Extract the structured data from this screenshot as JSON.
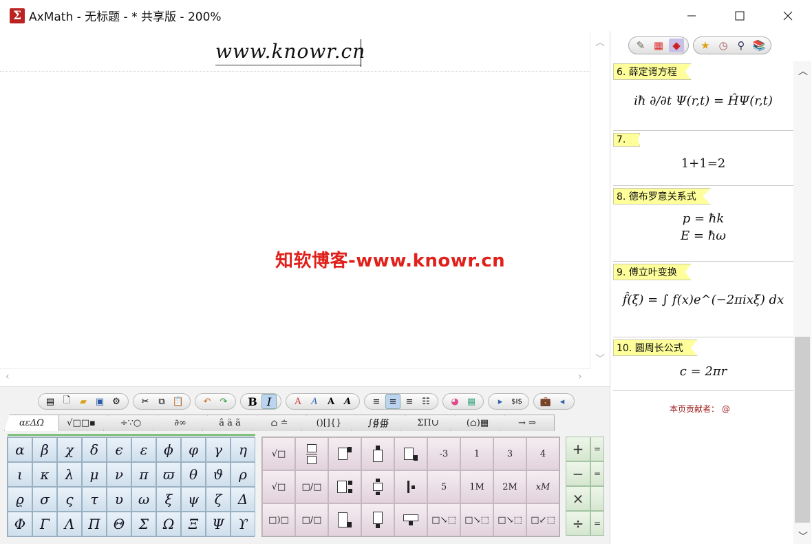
{
  "window": {
    "title": "AxMath - 无标题 - * 共享版 - 200%",
    "app_icon": "Σ",
    "minimize": "minimize-icon",
    "maximize": "maximize-icon",
    "close": "close-icon"
  },
  "editor": {
    "formula": "www.knowr.cn",
    "watermark": "知软博客-www.knowr.cn"
  },
  "toolbar": {
    "bold": "B",
    "italic": "I",
    "font_a1": "A",
    "font_a2": "A",
    "font_a3": "A",
    "font_a4": "A"
  },
  "tabs": [
    "αεΔΩ",
    "√□□▪",
    "÷∵○",
    "∂∞",
    "â ä ã",
    "⌂ ≐",
    "()[]{}",
    "∫∯∰",
    "ΣΠ∪",
    "(⌂)▦",
    "→ ⇒"
  ],
  "greek": [
    [
      "α",
      "β",
      "χ",
      "δ",
      "ϵ",
      "ε",
      "ϕ",
      "φ",
      "γ",
      "η"
    ],
    [
      "ι",
      "κ",
      "λ",
      "μ",
      "ν",
      "π",
      "ϖ",
      "θ",
      "ϑ",
      "ρ"
    ],
    [
      "ϱ",
      "σ",
      "ς",
      "τ",
      "υ",
      "ω",
      "ξ",
      "ψ",
      "ζ",
      "Δ"
    ],
    [
      "Φ",
      "Γ",
      "Λ",
      "Π",
      "Θ",
      "Σ",
      "Ω",
      "Ξ",
      "Ψ",
      "ϒ"
    ]
  ],
  "templates": {
    "row1": [
      "√□",
      "□/□",
      "",
      "",
      "",
      "-3",
      "1",
      "3",
      "4"
    ],
    "row2": [
      "√□",
      "□/□",
      "",
      "",
      "",
      "5",
      "1M",
      "2M",
      "xM"
    ],
    "row3": [
      "□)□",
      "□/□",
      "",
      "",
      "",
      "",
      "",
      "",
      ""
    ]
  },
  "operators": [
    "+",
    "−",
    "×",
    "÷"
  ],
  "sidebar": {
    "entries": [
      {
        "tag": "6. 薛定谔方程",
        "lines": [
          "iħ ∂/∂t Ψ(r,t) = ĤΨ(r,t)"
        ]
      },
      {
        "tag": "7.",
        "lines": [
          "1+1=2"
        ]
      },
      {
        "tag": "8. 德布罗意关系式",
        "lines": [
          "p = ħk",
          "E = ħω"
        ]
      },
      {
        "tag": "9. 傅立叶变换",
        "lines": [
          "f̂(ξ) = ∫ f(x)e^(−2πixξ) dx"
        ]
      },
      {
        "tag": "10. 圆周长公式",
        "lines": [
          "c = 2πr"
        ]
      }
    ],
    "contributor": "本页贡献者：  @"
  },
  "colors": {
    "watermark": "#e0201b",
    "tag_bg": "#fefe9a",
    "greek_cell": "#cfdfec",
    "template_cell": "#e2d2dc",
    "ops_cell": "#d5e6cf"
  }
}
